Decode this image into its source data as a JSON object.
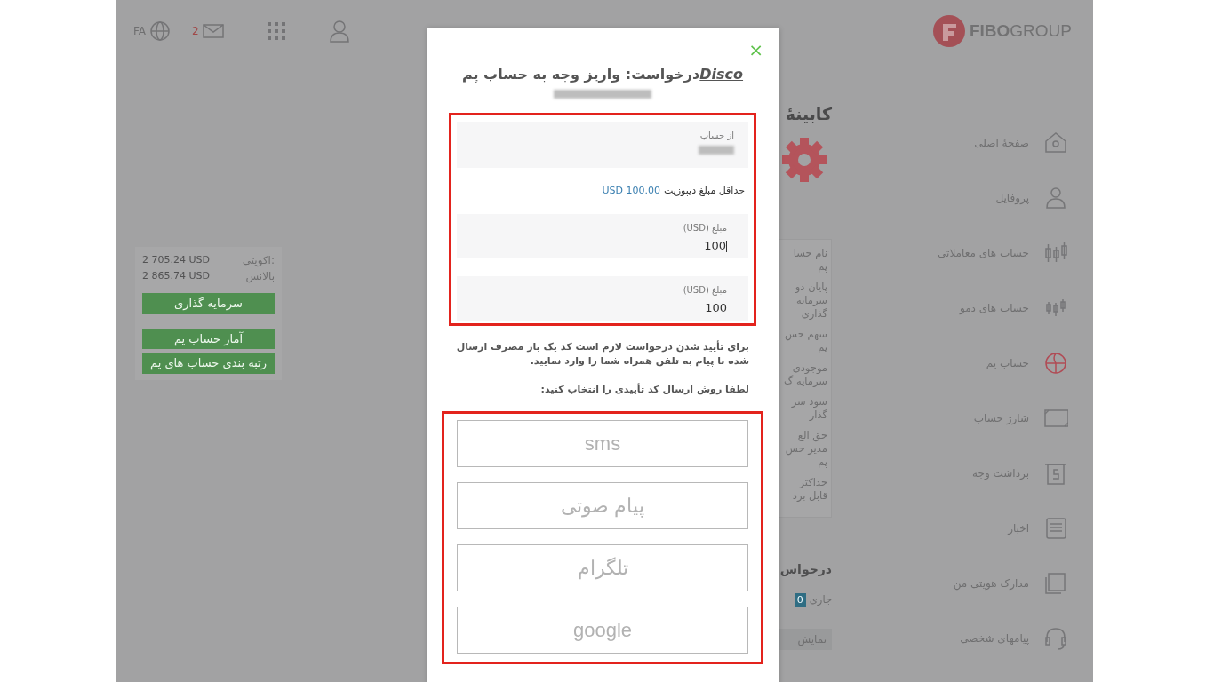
{
  "header": {
    "logo": "**FIBO**GROUP",
    "language": "FA",
    "unread_count": "2"
  },
  "sidebar": {
    "items": [
      {
        "label": "صفحهٔ اصلی",
        "selected": false
      },
      {
        "label": "پروفایل",
        "selected": false
      },
      {
        "label": "حساب های معاملاتی",
        "selected": false
      },
      {
        "label": "حساب های دمو",
        "selected": false
      },
      {
        "label": "حساب پم",
        "selected": true
      },
      {
        "label": "شارژ حساب",
        "selected": false
      },
      {
        "label": "برداشت وجه",
        "selected": false
      },
      {
        "label": "اخبار",
        "selected": false
      },
      {
        "label": "مدارک هویتی من",
        "selected": false
      },
      {
        "label": "پیامهای شخصی",
        "selected": false
      }
    ]
  },
  "cabinet": {
    "title": "کابینهٔ",
    "fields": [
      {
        "lines": [
          "نام حسا",
          "پم"
        ]
      },
      {
        "lines": [
          "پایان دو",
          "سرمایه",
          "گذاری"
        ]
      },
      {
        "lines": [
          "سهم حس",
          "پم"
        ]
      },
      {
        "lines": [
          "موجودی",
          "سرمایه گ"
        ]
      },
      {
        "lines": [
          "سود سر",
          "گذار"
        ]
      },
      {
        "lines": [
          "حق الع",
          "مدیر حس",
          "پم"
        ]
      },
      {
        "lines": [
          "حداکثر",
          "قابل برد"
        ]
      }
    ],
    "requests_title": "درخواس",
    "status": "جاری",
    "status_count": "0",
    "show_button": "نمایش"
  },
  "account_panel": {
    "rows": [
      {
        "label": "اکویتی:",
        "value": "2 705.24 USD"
      },
      {
        "label": "بالانس",
        "value": "2 865.74 USD"
      }
    ],
    "buttons": [
      "سرمایه گذاری",
      "آمار حساب پم",
      "رتبه بندی حساب های پم"
    ]
  },
  "dialog": {
    "close": "×",
    "title_link": "Disco",
    "title": "درخواست: واریز وجه به حساب پم",
    "from_account": {
      "label": "از حساب"
    },
    "min_deposit": {
      "label": "حداقل مبلغ دیپوزیت",
      "value": "100.00 USD"
    },
    "amount_fields": [
      {
        "label": "مبلغ (USD)",
        "value": "100",
        "focused": true
      },
      {
        "label": "مبلغ (USD)",
        "value": "100",
        "focused": false
      }
    ],
    "message": "برای تأیید شدن درخواست لازم است کد یک بار مصرف ارسال شده با پیام به تلفن همراه شما را وارد نمایید.",
    "prompt": "لطفا روش ارسال کد تأییدی را انتخاب کنید:",
    "methods": [
      "sms",
      "پیام صوتی",
      "تلگرام",
      "google"
    ]
  }
}
